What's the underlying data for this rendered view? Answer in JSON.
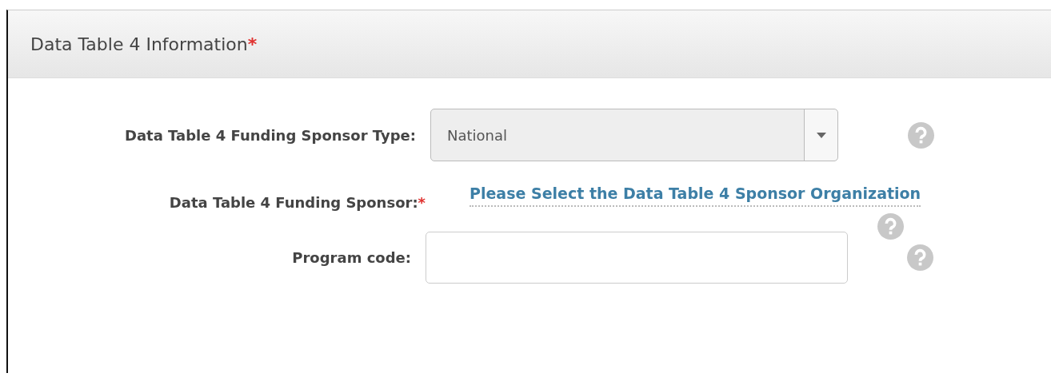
{
  "panel": {
    "title": "Data Table 4 Information",
    "required_mark": "*"
  },
  "fields": [
    {
      "kind": "select",
      "label": "Data Table 4 Funding Sponsor Type:",
      "value": "National",
      "disabled": true,
      "help": true
    },
    {
      "kind": "link",
      "label": "Data Table 4 Funding Sponsor:",
      "required_mark": "*",
      "value": "Please Select the Data Table 4 Sponsor Organization",
      "help": true
    },
    {
      "kind": "text",
      "label": "Program code:",
      "help": true
    }
  ]
}
